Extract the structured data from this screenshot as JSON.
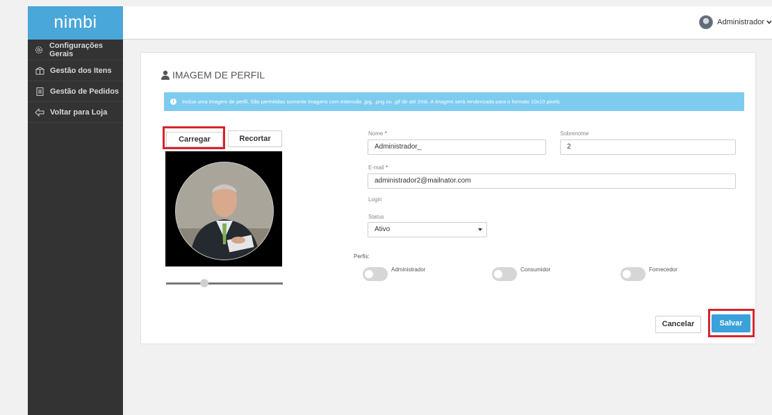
{
  "app": {
    "logo": "nimbi"
  },
  "sidebar": {
    "items": [
      {
        "label": "Configurações Gerais",
        "icon": "gear-icon"
      },
      {
        "label": "Gestão dos Itens",
        "icon": "box-icon"
      },
      {
        "label": "Gestão de Pedidos",
        "icon": "document-icon"
      },
      {
        "label": "Voltar para Loja",
        "icon": "back-arrow-icon"
      }
    ]
  },
  "header": {
    "user_name": "Administrador"
  },
  "card": {
    "title": "IMAGEM DE PERFIL",
    "info": "Inclua uma imagem de perfil. São permitidas somente imagens com extensão .jpg, .png ou .gif de até 2mb. A imagem será renderizada para o formato 10x10 pixels",
    "upload_label": "Carregar",
    "crop_label": "Recortar",
    "form": {
      "nome_label": "Nome",
      "nome_value": "Administrador_",
      "sobrenome_label": "Sobrenome",
      "sobrenome_value": "2",
      "email_label": "E-mail",
      "email_value": "administrador2@mailnator.com",
      "login_label": "Login",
      "status_label": "Status",
      "status_value": "Ativo",
      "required_mark": "*"
    },
    "perfis": {
      "title": "Perfis:",
      "items": [
        {
          "label": "Administrador",
          "on": false
        },
        {
          "label": "Consumidor",
          "on": false
        },
        {
          "label": "Fornecedor",
          "on": false
        }
      ]
    },
    "cancel_label": "Cancelar",
    "save_label": "Salvar"
  },
  "colors": {
    "accent": "#3aa1da",
    "sidebar": "#333333",
    "highlight": "#d9232d",
    "info": "#7ecbf0"
  }
}
